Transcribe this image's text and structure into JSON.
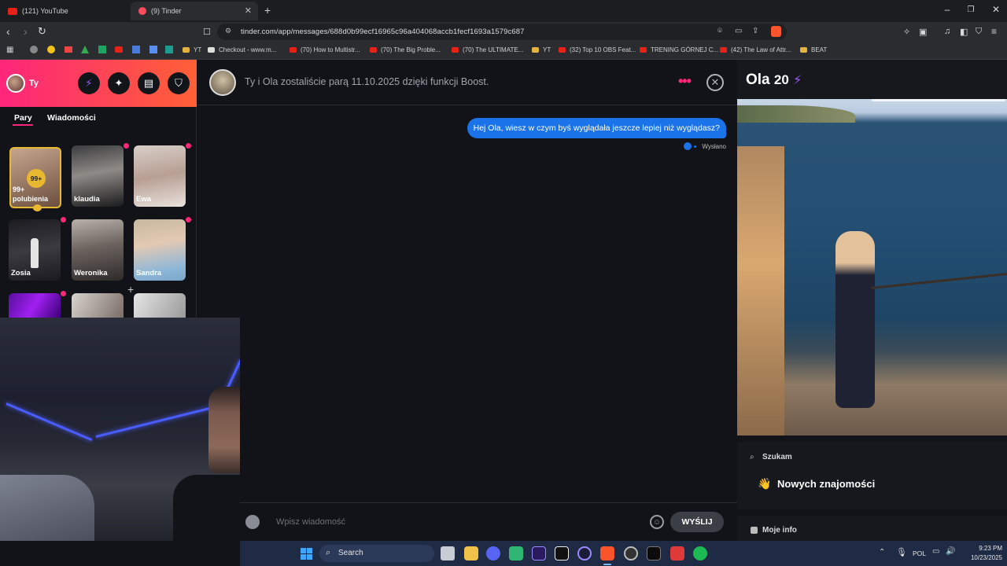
{
  "browser": {
    "tabs": [
      {
        "label": "(121) YouTube",
        "active": false
      },
      {
        "label": "(9) Tinder",
        "active": true
      }
    ],
    "url": "tinder.com/app/messages/688d0b99ecf16965c96a404068accb1fecf1693a1579c687",
    "bookmarks": [
      "Checkout - www.m...",
      "(70) How to Multistr...",
      "(70) The Big Proble...",
      "(70) The ULTIMATE...",
      "YT",
      "(32) Top 10 OBS Feat...",
      "TRENING GÓRNEJ C...",
      "(42) The Law of Attr...",
      "BEAT"
    ],
    "bookmark_yt": "YT"
  },
  "left": {
    "user_label": "Ty",
    "tabs": [
      "Pary",
      "Wiadomości"
    ],
    "likes_badge": "99+",
    "likes_label": "99+ polubienia",
    "matches": [
      "klaudia",
      "Ewa",
      "Zosia",
      "Weronika",
      "Sandra"
    ]
  },
  "chat": {
    "header_text": "Ty i Ola zostaliście parą 11.10.2025 dzięki funkcji Boost.",
    "message": "Hej Ola, wiesz w czym byś wyglądała jeszcze lepiej niż wyglądasz?",
    "status": "Wysłano",
    "input_placeholder": "Wpisz wiadomość",
    "send_label": "WYŚLIJ"
  },
  "profile": {
    "name": "Ola",
    "age": "20",
    "looking_label": "Szukam",
    "looking_value": "Nowych znajomości",
    "info_label": "Moje info"
  },
  "taskbar": {
    "search": "Search",
    "lang": "POL",
    "time": "9:23 PM",
    "date": "10/23/2025"
  },
  "colors": {
    "brand_gradient_start": "#fd267a",
    "brand_gradient_end": "#ff6036",
    "message_blue": "#1a73e8"
  }
}
